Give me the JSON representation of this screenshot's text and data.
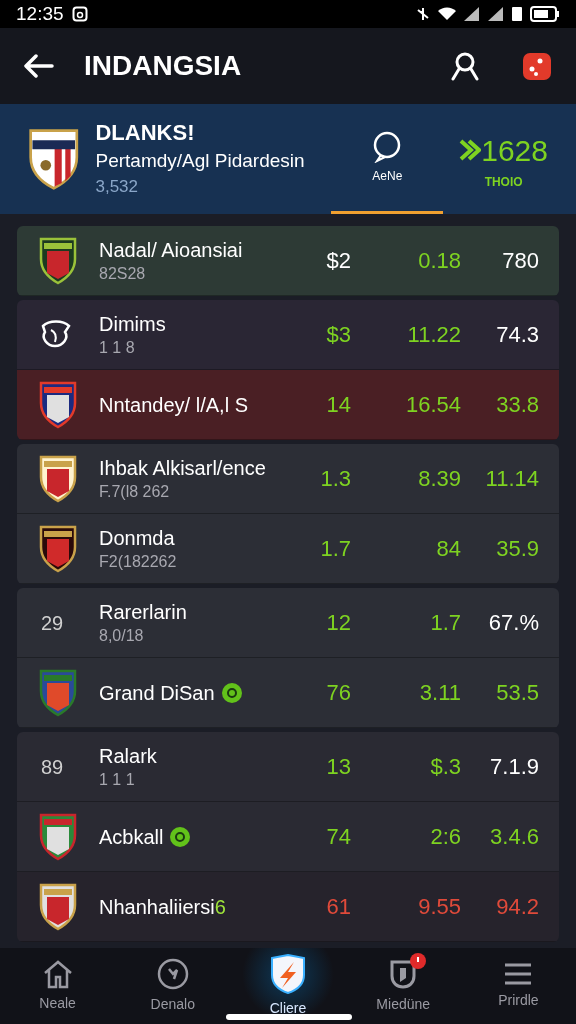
{
  "status_bar": {
    "time": "12:35"
  },
  "app_bar": {
    "title": "INDANGSIA"
  },
  "header": {
    "title": "DLANKS!",
    "subtitle": "Pertamdy/Agl Pidardesin",
    "count": "3,532",
    "tab": {
      "label": "AeNe",
      "selected": true
    },
    "stat": {
      "value": "1628",
      "label": "THOIO"
    }
  },
  "groups": [
    {
      "rows": [
        {
          "kind": "crest",
          "name": "Nadal/ Aioansiai",
          "sub": "82S28",
          "color": "#2d3a35",
          "values": [
            {
              "text": "$2",
              "color": "#ffffff"
            },
            {
              "text": "0.18",
              "color": "#7ed321"
            },
            {
              "text": "780",
              "color": "#ffffff"
            }
          ]
        }
      ]
    },
    {
      "rows": [
        {
          "kind": "emblem",
          "name": "Dimims",
          "sub": "1 1 8",
          "color": "#2a2634",
          "values": [
            {
              "text": "$3",
              "color": "#7ed321"
            },
            {
              "text": "11.22",
              "color": "#7ed321"
            },
            {
              "text": "74.3",
              "color": "#ffffff"
            }
          ]
        },
        {
          "kind": "crest",
          "name": "Nntandey/ l/A,l S",
          "color": "#4a1f24",
          "values": [
            {
              "text": "14",
              "color": "#7ed321"
            },
            {
              "text": "16.54",
              "color": "#7ed321"
            },
            {
              "text": "33.8",
              "color": "#7ed321"
            }
          ]
        }
      ]
    },
    {
      "rows": [
        {
          "kind": "crest",
          "name": "Ihbak Alkisarl/ence",
          "sub": "F.7(l8 262",
          "color": "#2c2e36",
          "values": [
            {
              "text": "1.3",
              "color": "#7ed321"
            },
            {
              "text": "8.39",
              "color": "#7ed321"
            },
            {
              "text": "11.14",
              "color": "#7ed321"
            }
          ]
        },
        {
          "kind": "crest",
          "name": "Donmda",
          "sub": "F2(182262",
          "color": "#2c2e36",
          "values": [
            {
              "text": "1.7",
              "color": "#7ed321"
            },
            {
              "text": "84",
              "color": "#7ed321"
            },
            {
              "text": "35.9",
              "color": "#7ed321"
            }
          ]
        }
      ]
    },
    {
      "rows": [
        {
          "kind": "ranked",
          "rank": "29",
          "name": "Rarerlarin",
          "sub": "8,0/18",
          "color": "#2c2e36",
          "values": [
            {
              "text": "12",
              "color": "#7ed321"
            },
            {
              "text": "1.7",
              "color": "#7ed321"
            },
            {
              "text": "67.%",
              "color": "#ffffff"
            }
          ]
        },
        {
          "kind": "crest",
          "name": "Grand DiSan",
          "badge": true,
          "color": "#2c2e36",
          "values": [
            {
              "text": "76",
              "color": "#7ed321"
            },
            {
              "text": "3.11",
              "color": "#7ed321"
            },
            {
              "text": "53.5",
              "color": "#7ed321"
            }
          ]
        }
      ]
    },
    {
      "rows": [
        {
          "kind": "ranked",
          "rank": "89",
          "name": "Ralark",
          "sub": "1 1 1",
          "color": "#2a2a33",
          "values": [
            {
              "text": "13",
              "color": "#7ed321"
            },
            {
              "text": "$.3",
              "color": "#7ed321"
            },
            {
              "text": "7.1.9",
              "color": "#ffffff"
            }
          ]
        },
        {
          "kind": "crest",
          "name": "Acbkall",
          "badge": true,
          "color": "#2a2a33",
          "values": [
            {
              "text": "74",
              "color": "#7ed321"
            },
            {
              "text": "2:6",
              "color": "#7ed321"
            },
            {
              "text": "3.4.6",
              "color": "#7ed321"
            }
          ]
        },
        {
          "kind": "crest",
          "name": "Nhanhaliiersi",
          "suffix": "6",
          "color": "#26232c",
          "values": [
            {
              "text": "61",
              "color": "#e04a3a"
            },
            {
              "text": "9.55",
              "color": "#e04a3a"
            },
            {
              "text": "94.2",
              "color": "#e04a3a"
            }
          ]
        }
      ]
    }
  ],
  "nav": [
    {
      "label": "Neale",
      "selected": false,
      "badge": false
    },
    {
      "label": "Denalo",
      "selected": false,
      "badge": false
    },
    {
      "label": "Cliere",
      "selected": true,
      "badge": false
    },
    {
      "label": "Miedüne",
      "selected": false,
      "badge": true
    },
    {
      "label": "Prirdle",
      "selected": false,
      "badge": false
    }
  ]
}
